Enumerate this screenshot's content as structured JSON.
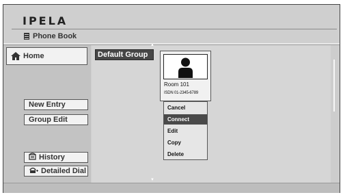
{
  "app": {
    "brand": "IPELA",
    "section_title": "Phone Book"
  },
  "sidebar": {
    "home_label": "Home",
    "new_entry_label": "New Entry",
    "group_edit_label": "Group Edit",
    "history_label": "History",
    "detailed_dial_label": "Detailed Dial"
  },
  "group": {
    "selected": "Default Group"
  },
  "entry": {
    "name": "Room 101",
    "number": "ISDN 01-2345-6789"
  },
  "context_menu": {
    "items": [
      "Cancel",
      "Connect",
      "Edit",
      "Copy",
      "Delete"
    ],
    "selected": "Connect"
  },
  "icons": {
    "home": "house-icon",
    "history": "phone-history-icon",
    "detailed_dial": "phone-dial-icon",
    "phone_book": "book-icon",
    "avatar": "person-silhouette-icon"
  }
}
